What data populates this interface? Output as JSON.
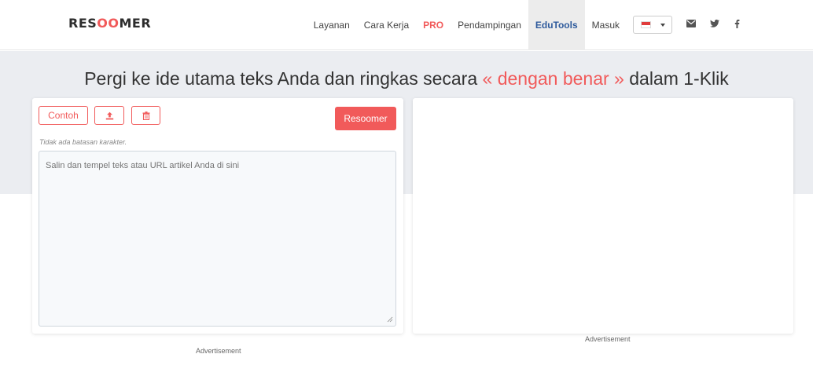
{
  "logo": {
    "before": "RES",
    "accent": "OO",
    "after": "MER"
  },
  "nav": {
    "items": [
      "Layanan",
      "Cara Kerja",
      "PRO",
      "Pendampingan",
      "EduTools",
      "Masuk"
    ]
  },
  "language": {
    "flag": "indonesia-flag",
    "colors": [
      "#e03b3b",
      "#ffffff"
    ]
  },
  "social": [
    "mail-icon",
    "twitter-icon",
    "facebook-icon"
  ],
  "headline": {
    "before": "Pergi ke ide utama teks Anda dan ringkas secara ",
    "accent": "« dengan benar »",
    "after": " dalam 1-Klik"
  },
  "editor": {
    "example_label": "Contoh",
    "upload_icon": "upload-icon",
    "delete_icon": "trash-icon",
    "submit_label": "Resoomer",
    "hint": "Tidak ada batasan karakter.",
    "placeholder": "Salin dan tempel teks atau URL artikel Anda di sini"
  },
  "ads": {
    "left": "Advertisement",
    "right": "Advertisement"
  },
  "colors": {
    "accent": "#f15a5a",
    "edutools": "#2e5a9c",
    "hero_bg": "#ebedf1"
  }
}
